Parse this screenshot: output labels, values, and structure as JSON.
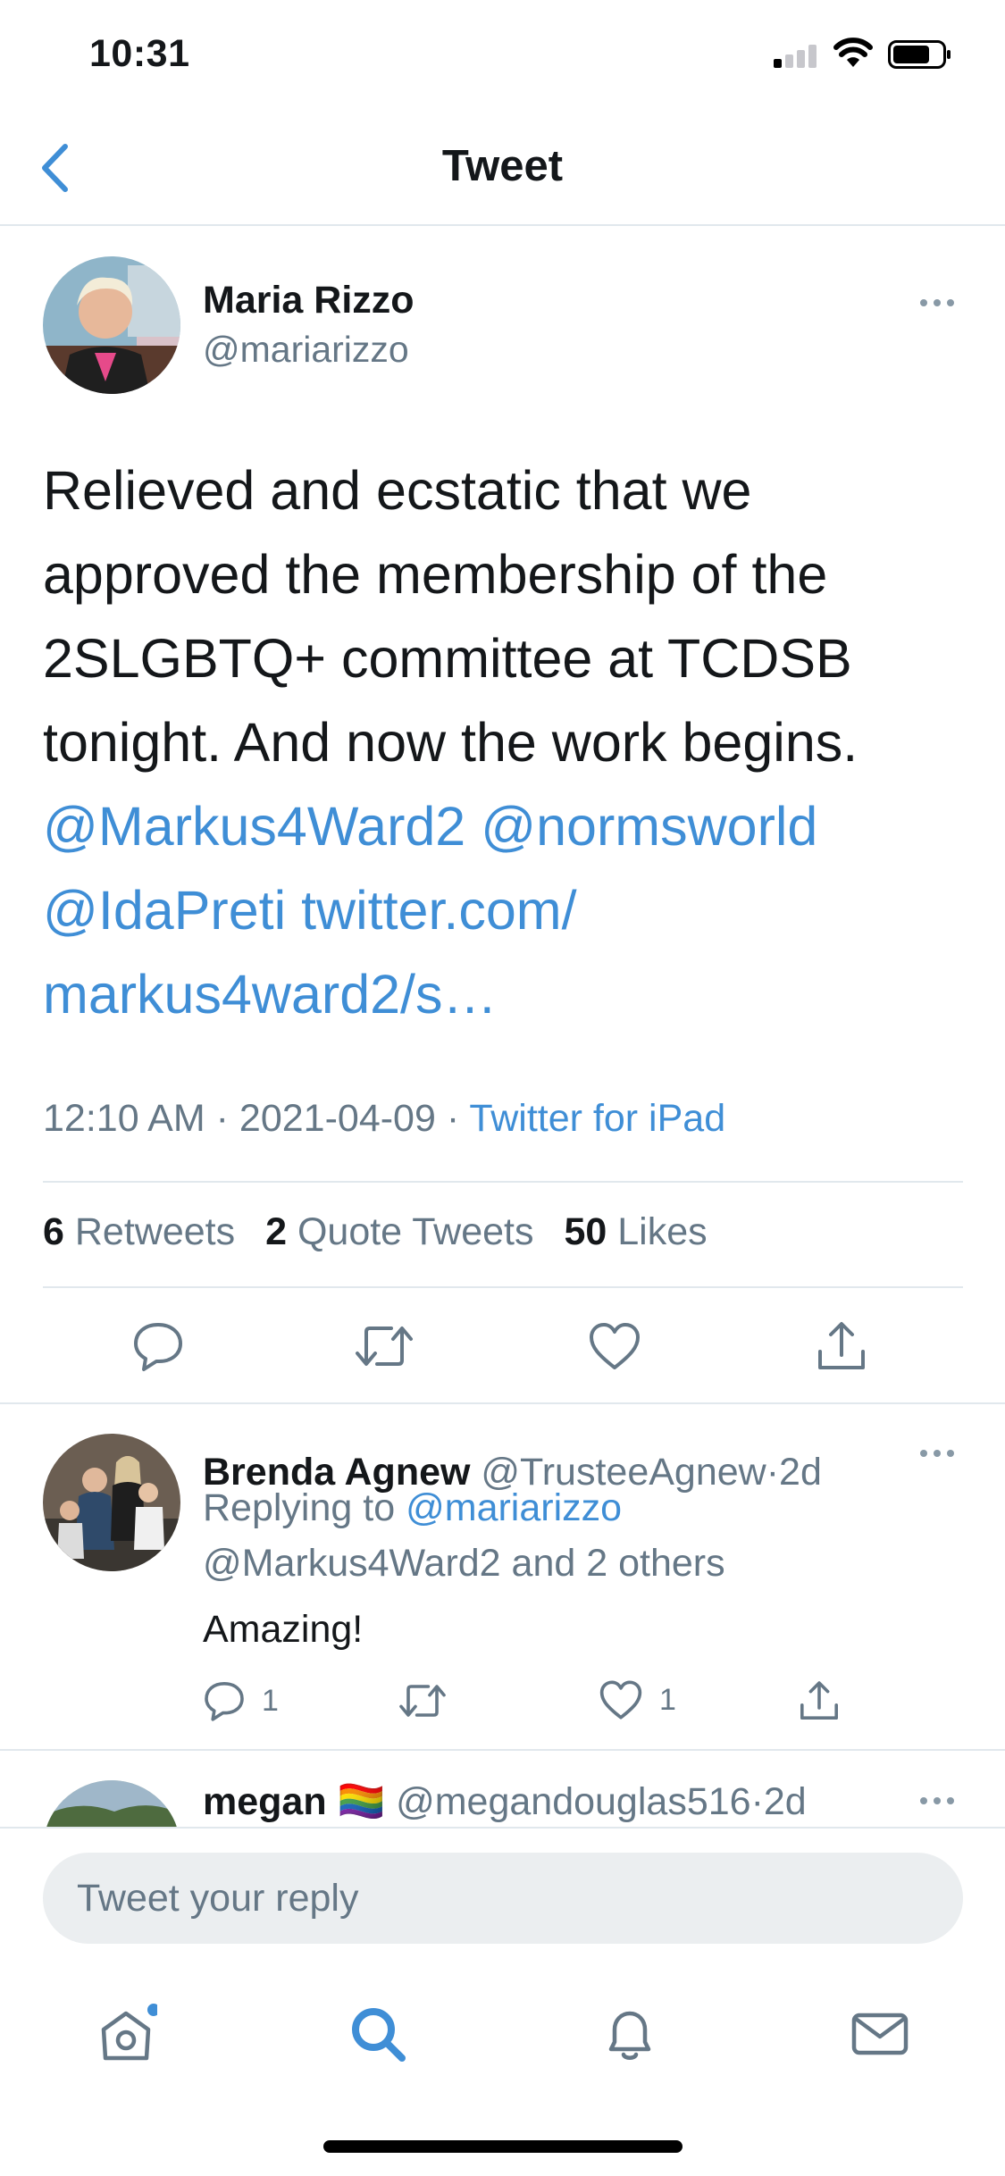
{
  "status_bar": {
    "time": "10:31"
  },
  "nav": {
    "title": "Tweet"
  },
  "tweet": {
    "author_name": "Maria Rizzo",
    "author_handle": "@mariarizzo",
    "text_lines": [
      "Relieved and ecstatic that we",
      "approved the  membership of the",
      "2SLGBTQ+ committee at TCDSB",
      "tonight. And now the work begins."
    ],
    "mentions": [
      "@Markus4Ward2",
      "@normsworld",
      "@IdaPreti"
    ],
    "link_part1": "twitter.com/",
    "link_part2": "markus4ward2/s…",
    "time": "12:10 AM",
    "date": "2021-04-09",
    "separator": "·",
    "source": "Twitter for iPad",
    "retweets_count": "6",
    "retweets_label": "Retweets",
    "quotes_count": "2",
    "quotes_label": "Quote Tweets",
    "likes_count": "50",
    "likes_label": "Likes"
  },
  "replies": [
    {
      "name": "Brenda Agnew",
      "handle": "@TrusteeAgnew",
      "age": "2d",
      "replying_prefix": "Replying to",
      "replying_to": "@mariarizzo",
      "replying_more": "@Markus4Ward2 and 2 others",
      "text": "Amazing!",
      "reply_count": "1",
      "like_count": "1"
    },
    {
      "name": "megan",
      "flag": "🏳️‍🌈",
      "handle": "@megandouglas516",
      "age": "2d"
    }
  ],
  "compose": {
    "placeholder": "Tweet your reply"
  },
  "colors": {
    "accent": "#3f8ed6",
    "secondary_text": "#657786",
    "divider": "#e1e8ed"
  },
  "icons": [
    "back-chevron-icon",
    "more-icon",
    "reply-icon",
    "retweet-icon",
    "like-icon",
    "share-icon",
    "home-icon",
    "search-icon",
    "notifications-icon",
    "messages-icon"
  ]
}
